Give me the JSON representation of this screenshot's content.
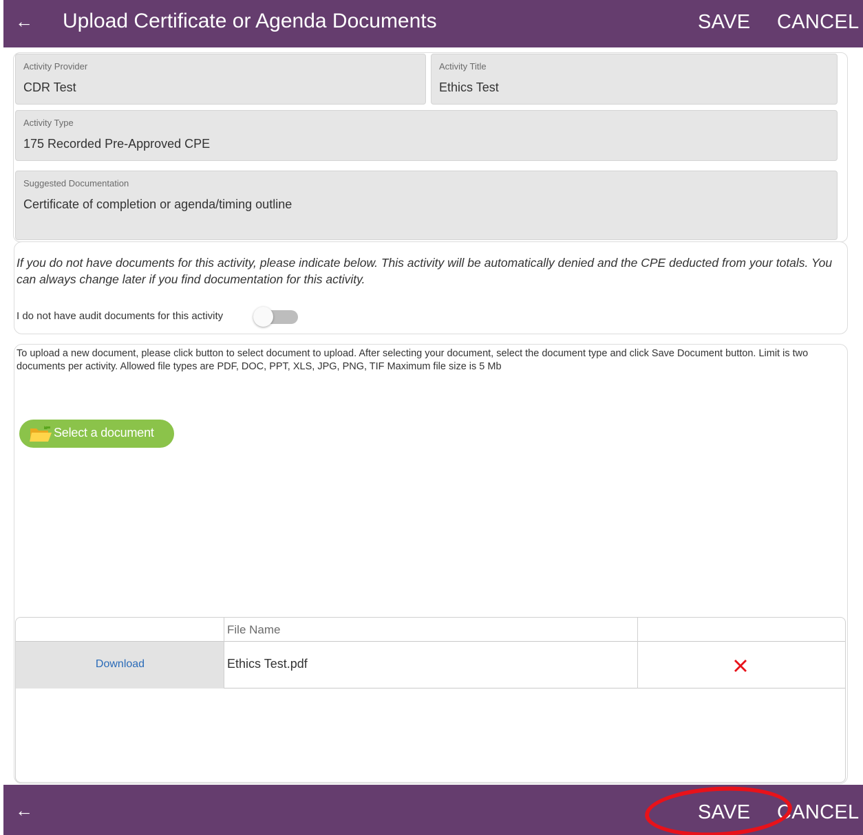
{
  "header": {
    "back_icon": "←",
    "title": "Upload Certificate or Agenda Documents",
    "save_label": "SAVE",
    "cancel_label": "CANCEL"
  },
  "fields": {
    "activity_provider": {
      "label": "Activity Provider",
      "value": "CDR Test"
    },
    "activity_title": {
      "label": "Activity Title",
      "value": "Ethics Test"
    },
    "activity_type": {
      "label": "Activity Type",
      "value": "175 Recorded Pre-Approved CPE"
    },
    "suggested_documentation": {
      "label": "Suggested Documentation",
      "value": "Certificate of completion or agenda/timing outline"
    }
  },
  "no_documents": {
    "note": "If you do not have documents for this activity, please indicate below.  This activity will be automatically denied and the CPE deducted from your totals.  You can always change later if you find documentation for this activity.",
    "toggle_label": "I do not have audit documents for this activity",
    "toggle_on": false
  },
  "upload": {
    "instructions": "To upload a new document, please click button to select document to upload. After selecting your document, select the document type and click Save Document button.  Limit is two documents per activity.  Allowed file types are PDF, DOC, PPT, XLS, JPG, PNG, TIF  Maximum file size is 5 Mb",
    "select_button_label": "Select a document",
    "select_button_icon": "folder-icon"
  },
  "documents_table": {
    "columns": [
      "",
      "File Name",
      ""
    ],
    "rows": [
      {
        "action": "Download",
        "file_name": "Ethics Test.pdf",
        "delete_icon": "red-x-icon"
      }
    ]
  },
  "footer": {
    "back_icon": "←",
    "save_label": "SAVE",
    "cancel_label": "CANCEL"
  },
  "colors": {
    "header_bg": "#653d6e",
    "button_green": "#8bc34a",
    "link_blue": "#2a6bb8",
    "delete_red": "#e8121a",
    "annotation_red": "#e8121a"
  }
}
